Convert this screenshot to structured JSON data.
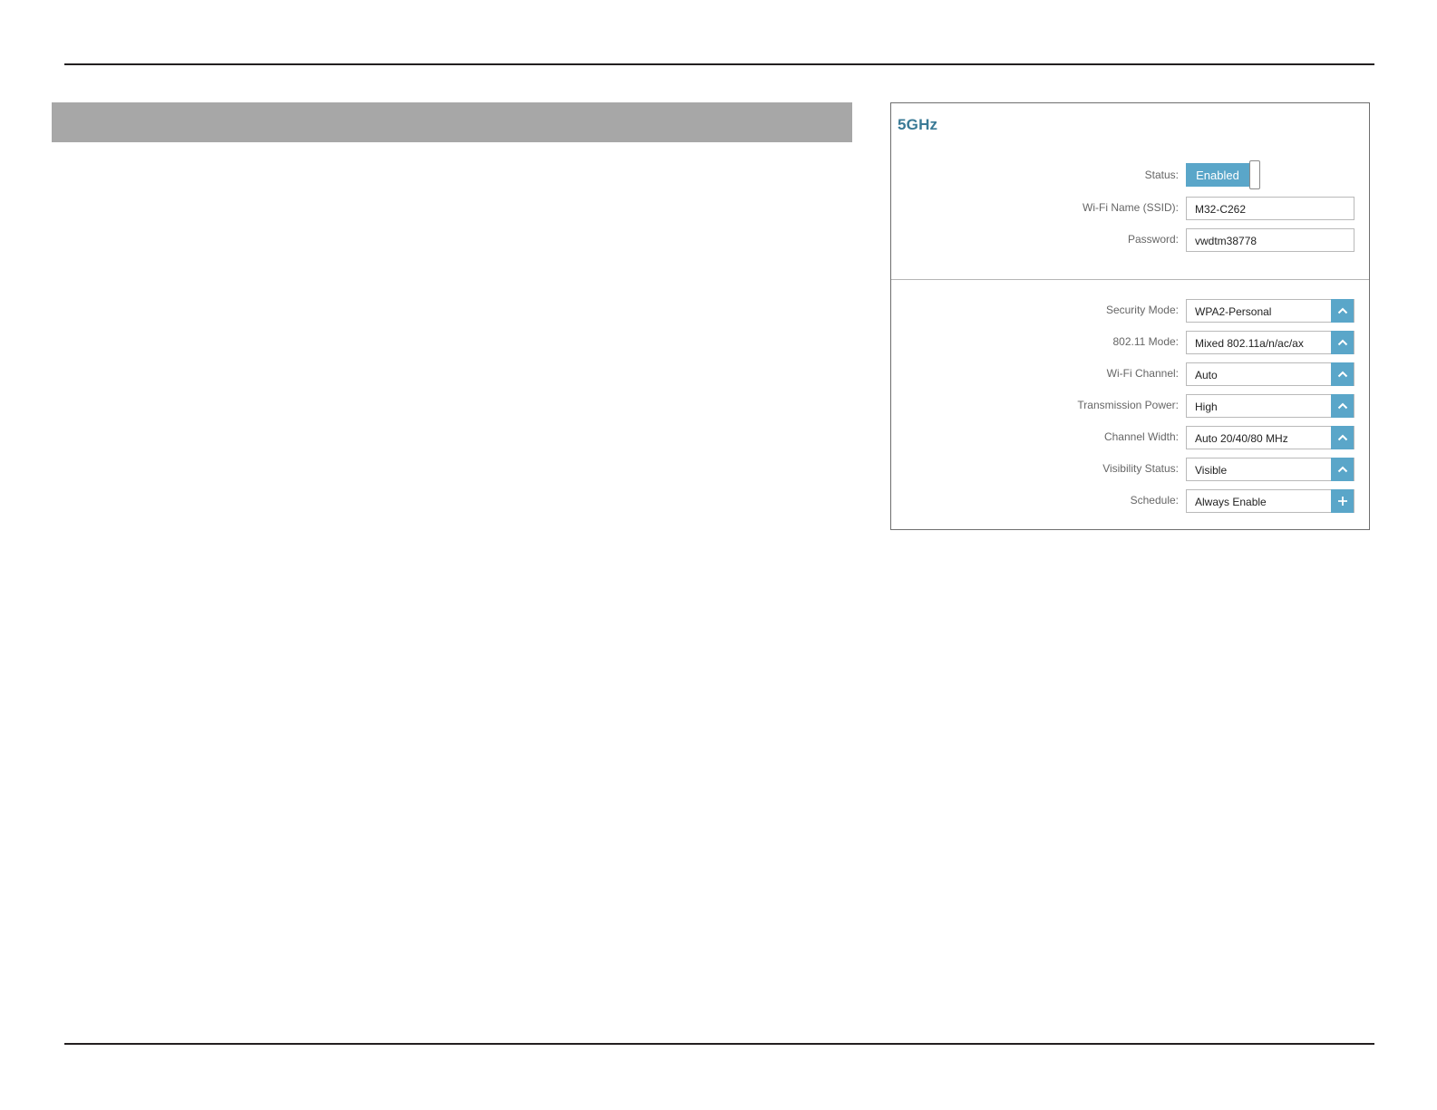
{
  "panel": {
    "title": "5GHz",
    "status": {
      "label": "Status:",
      "value": "Enabled"
    },
    "ssid": {
      "label": "Wi-Fi Name (SSID):",
      "value": "M32-C262"
    },
    "password": {
      "label": "Password:",
      "value": "vwdtm38778"
    },
    "selects": [
      {
        "label": "Security Mode:",
        "value": "WPA2-Personal",
        "icon": "chevron-up-icon"
      },
      {
        "label": "802.11 Mode:",
        "value": "Mixed 802.11a/n/ac/ax",
        "icon": "chevron-up-icon"
      },
      {
        "label": "Wi-Fi Channel:",
        "value": "Auto",
        "icon": "chevron-up-icon"
      },
      {
        "label": "Transmission Power:",
        "value": "High",
        "icon": "chevron-up-icon"
      },
      {
        "label": "Channel Width:",
        "value": "Auto 20/40/80 MHz",
        "icon": "chevron-up-icon"
      },
      {
        "label": "Visibility Status:",
        "value": "Visible",
        "icon": "chevron-up-icon"
      },
      {
        "label": "Schedule:",
        "value": "Always Enable",
        "icon": "plus-icon"
      }
    ]
  },
  "colors": {
    "accent": "#5aa6c9",
    "title": "#3a7a96",
    "header_bar": "#a7a7a7"
  }
}
